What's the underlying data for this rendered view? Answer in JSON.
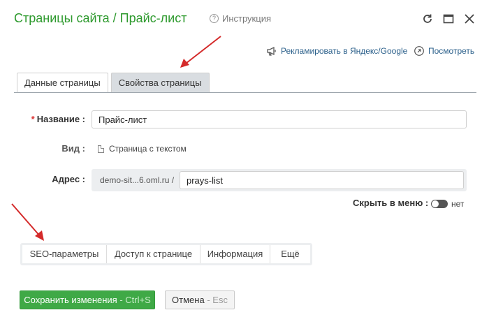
{
  "header": {
    "title": "Страницы сайта / Прайс-лист",
    "help_label": "Инструкция",
    "help_icon": "question-circle-icon"
  },
  "window_controls": [
    "refresh-icon",
    "maximize-icon",
    "close-icon"
  ],
  "promo": {
    "advertise_label": "Рекламировать в Яндекс/Google",
    "view_label": "Посмотреть"
  },
  "tabs": [
    {
      "label": "Данные страницы",
      "active": true
    },
    {
      "label": "Свойства страницы",
      "active": false
    }
  ],
  "form": {
    "name_label": "Название :",
    "name_value": "Прайс-лист",
    "view_label": "Вид :",
    "view_value": "Страница с текстом",
    "address_label": "Адрес :",
    "address_prefix": "demo-sit...6.oml.ru /",
    "address_value": "prays-list",
    "hide_menu_label": "Скрыть в меню :",
    "hide_menu_value": "нет"
  },
  "section_bar": [
    "SEO-параметры",
    "Доступ к странице",
    "Информация",
    "Ещё"
  ],
  "actions": {
    "save_label": "Сохранить изменения",
    "save_hint": "- Ctrl+S",
    "cancel_label": "Отмена",
    "cancel_hint": "- Esc"
  },
  "colors": {
    "title_green": "#2e9a2e",
    "save_green": "#3fa946",
    "link_blue": "#2a5f8a",
    "arrow_red": "#d42a2a"
  }
}
